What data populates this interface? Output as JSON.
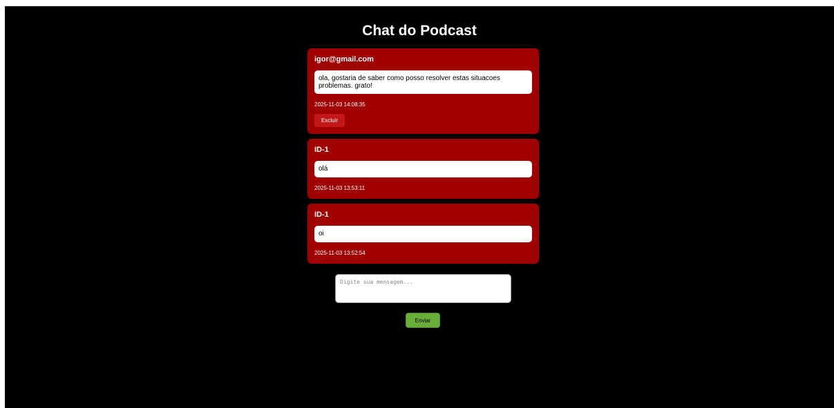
{
  "page": {
    "title": "Chat do Podcast"
  },
  "messages": [
    {
      "author": "igor@gmail.com",
      "text": "ola, gostaria de saber como posso resolver estas situacoes problemas. grato!",
      "timestamp": "2025-11-03 14:08:35",
      "delete_label": "Excluir"
    },
    {
      "author": "ID-1",
      "text": "olá",
      "timestamp": "2025-11-03 13:53:11"
    },
    {
      "author": "ID-1",
      "text": "oi",
      "timestamp": "2025-11-03 13:52:54"
    }
  ],
  "compose": {
    "placeholder": "Digite sua mensagem...",
    "value": "",
    "send_label": "Enviar"
  },
  "colors": {
    "background": "#000000",
    "card": "#a00000",
    "send_button": "#6aae3a"
  }
}
